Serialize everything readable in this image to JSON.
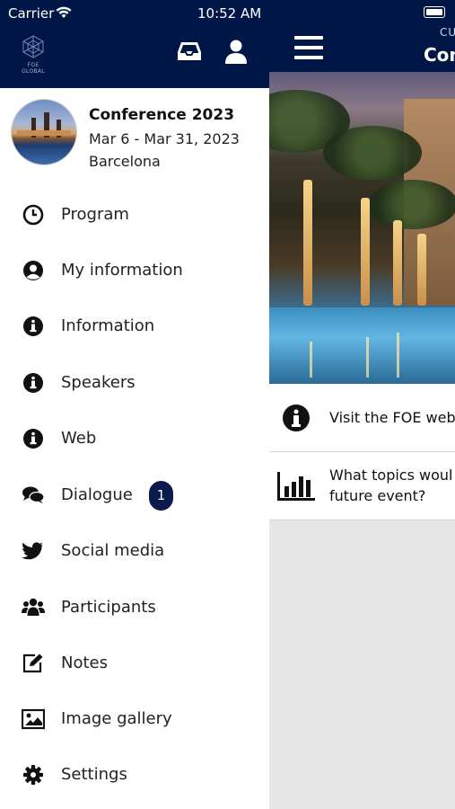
{
  "status_bar": {
    "carrier": "Carrier",
    "time": "10:52 AM"
  },
  "header": {
    "logo_text": "FOE GLOBAL",
    "icons": [
      "inbox-icon",
      "user-icon"
    ],
    "color": "#001647"
  },
  "event": {
    "title": "Conference 2023",
    "dates": "Mar 6 - Mar 31, 2023",
    "location": "Barcelona"
  },
  "menu": [
    {
      "label": "Program",
      "icon": "clock-icon"
    },
    {
      "label": "My information",
      "icon": "user-circle-icon"
    },
    {
      "label": "Information",
      "icon": "info-icon"
    },
    {
      "label": "Speakers",
      "icon": "info-icon"
    },
    {
      "label": "Web",
      "icon": "info-icon"
    },
    {
      "label": "Dialogue",
      "icon": "chat-icon",
      "badge": "1"
    },
    {
      "label": "Social media",
      "icon": "twitter-icon"
    },
    {
      "label": "Participants",
      "icon": "users-icon"
    },
    {
      "label": "Notes",
      "icon": "edit-icon"
    },
    {
      "label": "Image gallery",
      "icon": "image-icon"
    },
    {
      "label": "Settings",
      "icon": "gear-icon"
    }
  ],
  "main": {
    "header_super": "CU",
    "header_title": "Con",
    "cards": [
      {
        "icon": "info-icon",
        "text": "Visit the FOE web"
      },
      {
        "icon": "bar-chart-icon",
        "line1": "What topics woul",
        "line2": "future event?"
      }
    ]
  },
  "colors": {
    "navy": "#001647",
    "badge": "#0b1b4d",
    "panel_bg": "#e6e6e6"
  }
}
